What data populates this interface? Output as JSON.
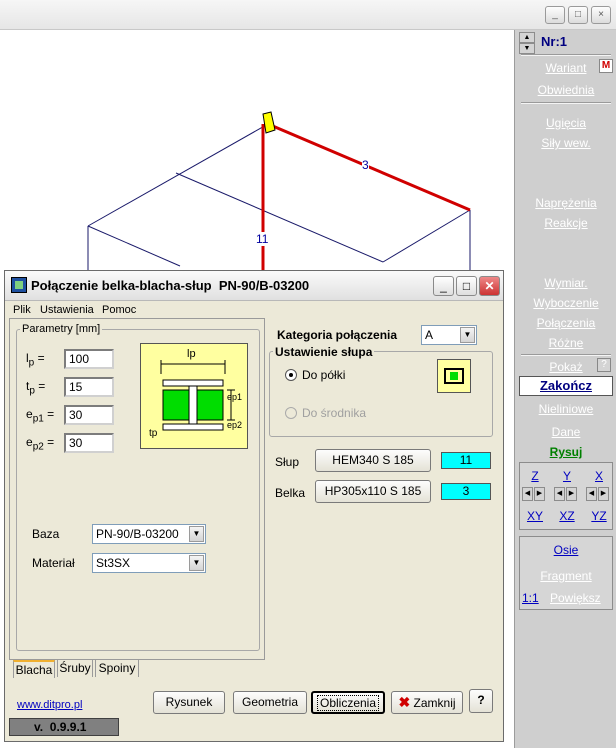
{
  "outer_window": {
    "buttons": [
      "_",
      "□",
      "×"
    ]
  },
  "drawing": {
    "member_label_beam": "3",
    "member_label_column": "11"
  },
  "right_panel": {
    "nr_label": "Nr:1",
    "m_badge": "M",
    "links_group1": [
      "Wariant",
      "Obwiednia"
    ],
    "links_group2": [
      "Ugięcia",
      "Siły wew."
    ],
    "links_group3": [
      "Naprężenia",
      "Reakcje"
    ],
    "links_group4": [
      "Wymiar.",
      "Wyboczenie",
      "Połączenia",
      "Różne"
    ],
    "pokaz": "Pokaż",
    "help": "?",
    "zakoncz": "Zakończ",
    "nieliniowe": "Nieliniowe",
    "dane": "Dane",
    "rysuj": "Rysuj",
    "axes_top": [
      "Z",
      "Y",
      "X"
    ],
    "axes_bottom": [
      "XY",
      "XZ",
      "YZ"
    ],
    "osie": "Osie",
    "fragment": "Fragment",
    "ratio": "1:1",
    "powieksz": "Powiększ"
  },
  "dialog": {
    "title": "Połączenie belka-blacha-słup  PN-90/B-03200",
    "menu": [
      "Plik",
      "Ustawienia",
      "Pomoc"
    ],
    "params_group": "Parametry [mm]",
    "params": [
      {
        "sym": "l",
        "sub": "p",
        "value": "100"
      },
      {
        "sym": "t",
        "sub": "p",
        "value": "15"
      },
      {
        "sym": "e",
        "sub": "p1",
        "value": "30"
      },
      {
        "sym": "e",
        "sub": "p2",
        "value": "30"
      }
    ],
    "figure_labels": {
      "lp": "lp",
      "ep1": "ep1",
      "ep2": "ep2",
      "tp": "tp"
    },
    "baza_label": "Baza",
    "baza_value": "PN-90/B-03200",
    "material_label": "Materiał",
    "material_value": "St3SX",
    "tabs": [
      "Blacha",
      "Śruby",
      "Spoiny"
    ],
    "kategoria_label": "Kategoria połączenia",
    "kategoria_value": "A",
    "ustawienie_label": "Ustawienie słupa",
    "radio_polki": "Do półki",
    "radio_srodnika": "Do środnika",
    "slup_label": "Słup",
    "slup_button": "HEM340  S 185",
    "slup_num": "11",
    "belka_label": "Belka",
    "belka_button": "HP305x110  S 185",
    "belka_num": "3",
    "website": "www.ditpro.pl",
    "version": "v.  0.9.9.1",
    "btn_rysunek": "Rysunek",
    "btn_geometria": "Geometria",
    "btn_obliczenia": "Obliczenia",
    "btn_zamknij": "Zamknij",
    "btn_help": "?"
  },
  "colors": {
    "cyan": "#00ffff",
    "green": "#00cc00",
    "member_red": "#d00000",
    "plate_yellow": "#ffffa0"
  }
}
